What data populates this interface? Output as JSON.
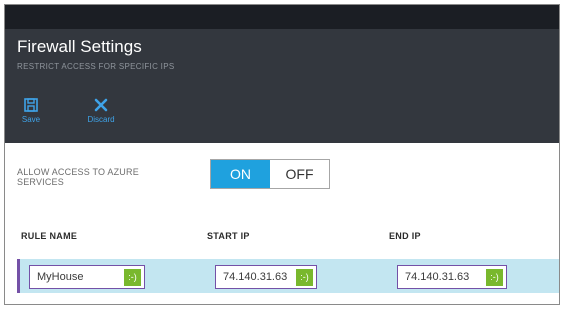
{
  "blade": {
    "title": "Firewall Settings",
    "subtitle": "RESTRICT ACCESS FOR SPECIFIC IPS"
  },
  "commands": [
    {
      "label": "Save",
      "icon": "save-icon"
    },
    {
      "label": "Discard",
      "icon": "discard-icon"
    }
  ],
  "azure_access": {
    "label": "ALLOW ACCESS TO AZURE SERVICES",
    "on_label": "ON",
    "off_label": "OFF",
    "selected": "ON"
  },
  "rules_table": {
    "columns": [
      "RULE NAME",
      "START IP",
      "END IP"
    ],
    "rows": [
      {
        "rule_name": "MyHouse",
        "start_ip": "74.140.31.63",
        "end_ip": "74.140.31.63",
        "status_glyph": ":-)"
      }
    ]
  },
  "colors": {
    "header_bg": "#33373e",
    "accent": "#1fa1de",
    "selection_row": "#c3e6f1",
    "valid_badge": "#79b82d",
    "field_border": "#7451a7"
  }
}
